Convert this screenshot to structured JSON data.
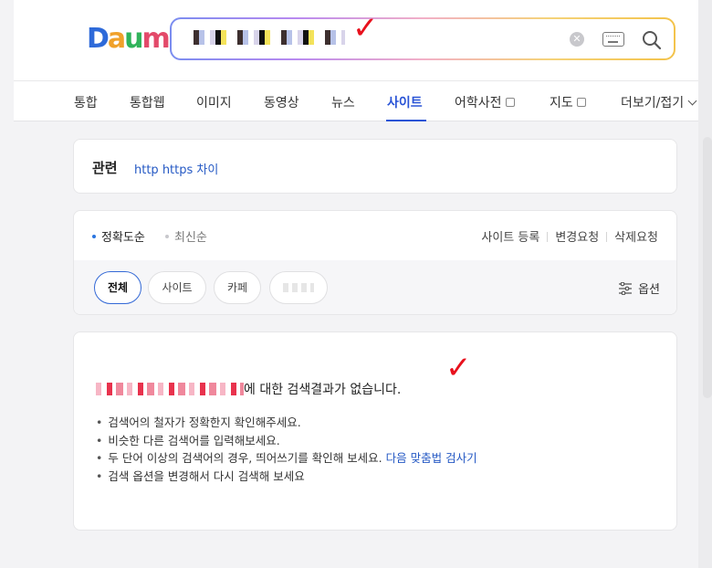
{
  "header": {
    "logo": [
      "D",
      "a",
      "u",
      "m"
    ],
    "logo_colors": [
      "#2e6ad9",
      "#f0a12a",
      "#30b35a",
      "#e34a6a"
    ],
    "search": {
      "query": "████████████████",
      "clear_icon": "close-circle-icon",
      "keyboard_icon": "keyboard-icon",
      "search_icon": "magnifier-icon"
    }
  },
  "tabs": [
    {
      "label": "통합"
    },
    {
      "label": "통합웹"
    },
    {
      "label": "이미지"
    },
    {
      "label": "동영상"
    },
    {
      "label": "뉴스"
    },
    {
      "label": "사이트"
    },
    {
      "label": "어학사전"
    },
    {
      "label": "지도"
    },
    {
      "label": "더보기/접기"
    }
  ],
  "related": {
    "title": "관련",
    "link": "http https 차이"
  },
  "filter": {
    "sort_accuracy": "정확도순",
    "sort_latest": "최신순",
    "links": [
      "사이트 등록",
      "변경요청",
      "삭제요청"
    ],
    "chips": [
      "전체",
      "사이트",
      "카페",
      "███"
    ],
    "options": "옵션"
  },
  "result": {
    "query": "████████████",
    "message": "에 대한 검색결과가 없습니다.",
    "tips": [
      "검색어의 철자가 정확한지 확인해주세요.",
      "비슷한 다른 검색어를 입력해보세요.",
      "두 단어 이상의 검색어의 경우, 띄어쓰기를 확인해 보세요.",
      "검색 옵션을 변경해서 다시 검색해 보세요"
    ],
    "tip_link": "다음 맞춤법 검사기"
  },
  "annotations": {
    "mark": "✓",
    "color": "#e8111d"
  },
  "colors": {
    "accent": "#2a54d6",
    "link": "#2559c4"
  }
}
